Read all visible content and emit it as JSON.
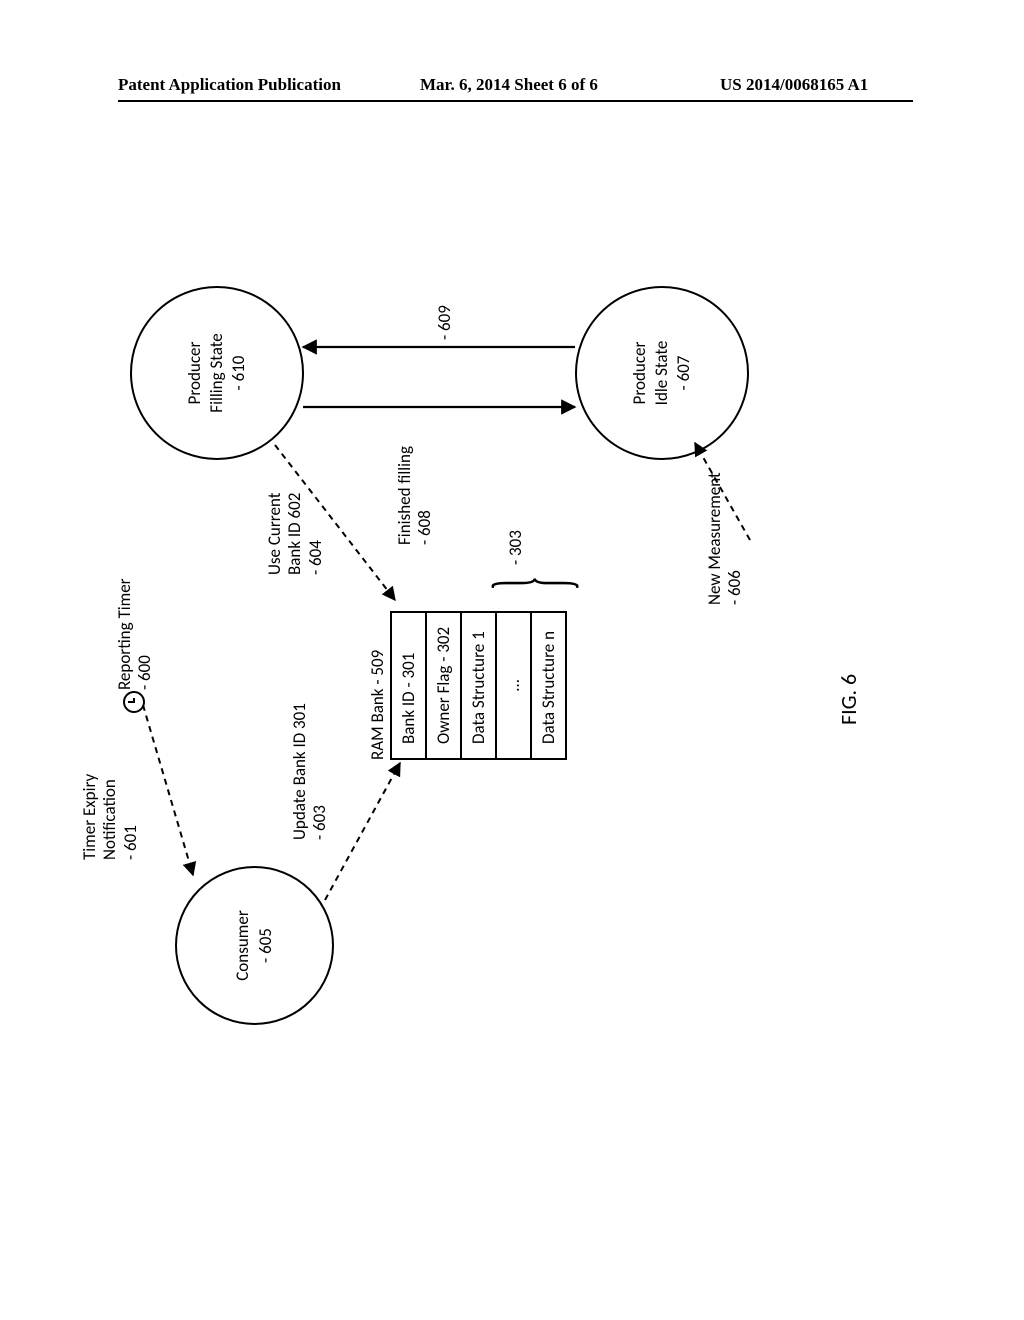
{
  "header": {
    "left": "Patent Application Publication",
    "center": "Mar. 6, 2014  Sheet 6 of 6",
    "right": "US 2014/0068165 A1"
  },
  "fig_label": "FIG. 6",
  "nodes": {
    "consumer": "Consumer\n- 605",
    "prod_filling": "Producer\nFilling State\n- 610",
    "prod_idle": "Producer\nIdle State\n- 607"
  },
  "ram_title": "RAM Bank  - 509",
  "ram_rows": {
    "r0": "Bank ID  - 301",
    "r1": "Owner Flag - 302",
    "r2": "Data Structure 1",
    "r3": "…",
    "r4": "Data Structure n"
  },
  "labels": {
    "timer_exp": "Timer Expiry\nNotification\n- 601",
    "reporting_timer": "Reporting Timer\n- 600",
    "update_bank": "Update Bank ID 301\n- 603",
    "use_current": "Use Current\nBank ID 602\n- 604",
    "finished": "Finished filling\n- 608",
    "trans_609": "- 609",
    "new_meas": "New Measurement\n- 606",
    "brace_303": "- 303"
  }
}
